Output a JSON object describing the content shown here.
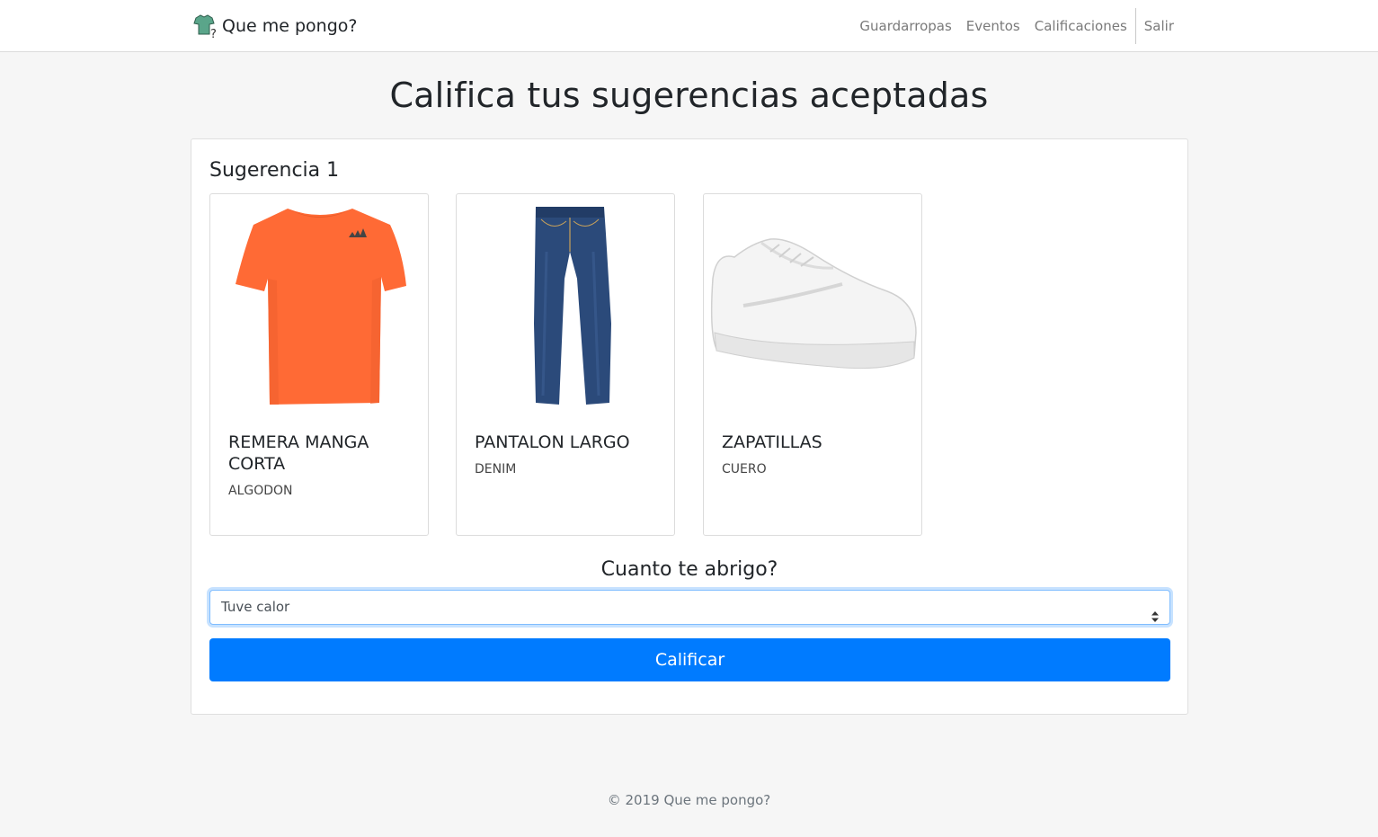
{
  "header": {
    "brand": "Que me pongo?",
    "brand_icon": "shirt-question-icon",
    "nav": [
      "Guardarropas",
      "Eventos",
      "Calificaciones"
    ],
    "logout": "Salir"
  },
  "page": {
    "title": "Califica tus sugerencias aceptadas"
  },
  "suggestion": {
    "title": "Sugerencia 1",
    "items": [
      {
        "name": "REMERA MANGA CORTA",
        "material": "ALGODON",
        "image": "orange-tshirt-image"
      },
      {
        "name": "PANTALON LARGO",
        "material": "DENIM",
        "image": "blue-jeans-image"
      },
      {
        "name": "ZAPATILLAS",
        "material": "CUERO",
        "image": "white-sneaker-image"
      }
    ],
    "question": "Cuanto te abrigo?",
    "select_value": "Tuve calor",
    "submit": "Calificar"
  },
  "footer": "© 2019 Que me pongo?",
  "colors": {
    "primary": "#007bff",
    "shirt": "#ff6a35",
    "jeans": "#2b4a7a"
  }
}
